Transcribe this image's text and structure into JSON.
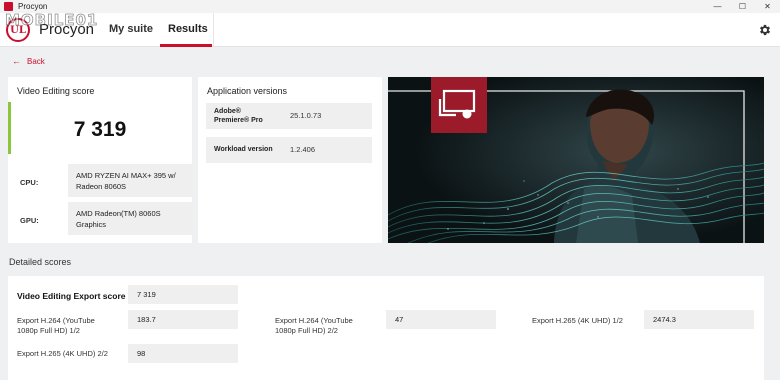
{
  "window": {
    "title": "Procyon",
    "controls": {
      "minimize": "—",
      "maximize": "☐",
      "close": "✕"
    }
  },
  "watermark": {
    "text": "MOBILE01"
  },
  "header": {
    "logo_text": "UL",
    "app_name": "Procyon",
    "tabs": [
      {
        "label": "My suite"
      },
      {
        "label": "Results"
      }
    ],
    "active_tab": "Results",
    "settings_icon": "gear-icon"
  },
  "back": {
    "label": "Back"
  },
  "score_card": {
    "title": "Video Editing score",
    "score": "7 319",
    "accent_color": "#8cc63f",
    "cpu_label": "CPU:",
    "cpu_value": "AMD RYZEN AI MAX+ 395 w/ Radeon 8060S",
    "gpu_label": "GPU:",
    "gpu_value": "AMD Radeon(TM) 8060S Graphics"
  },
  "versions_card": {
    "title": "Application versions",
    "rows": [
      {
        "key_line1": "Adobe®",
        "key_line2": "Premiere® Pro",
        "value": "25.1.0.73"
      },
      {
        "key_line1": "Workload version",
        "key_line2": "",
        "value": "1.2.406"
      }
    ]
  },
  "hero": {
    "icon": "video-editing-icon",
    "accent_color": "#9b1b2a"
  },
  "detailed": {
    "section_title": "Detailed scores",
    "main_label": "Video Editing Export score",
    "main_value": "7 319",
    "items": [
      {
        "label_line1": "Export H.264 (YouTube",
        "label_line2": "1080p Full HD) 1/2",
        "value": "183.7"
      },
      {
        "label_line1": "Export H.264 (YouTube",
        "label_line2": "1080p Full HD) 2/2",
        "value": "47"
      },
      {
        "label_line1": "Export H.265 (4K UHD) 1/2",
        "label_line2": "",
        "value": "2474.3"
      },
      {
        "label_line1": "Export H.265 (4K UHD) 2/2",
        "label_line2": "",
        "value": "98"
      }
    ]
  },
  "colors": {
    "brand": "#c8102e",
    "background": "#eef0f2",
    "panel": "#ffffff",
    "field": "#efefef"
  }
}
